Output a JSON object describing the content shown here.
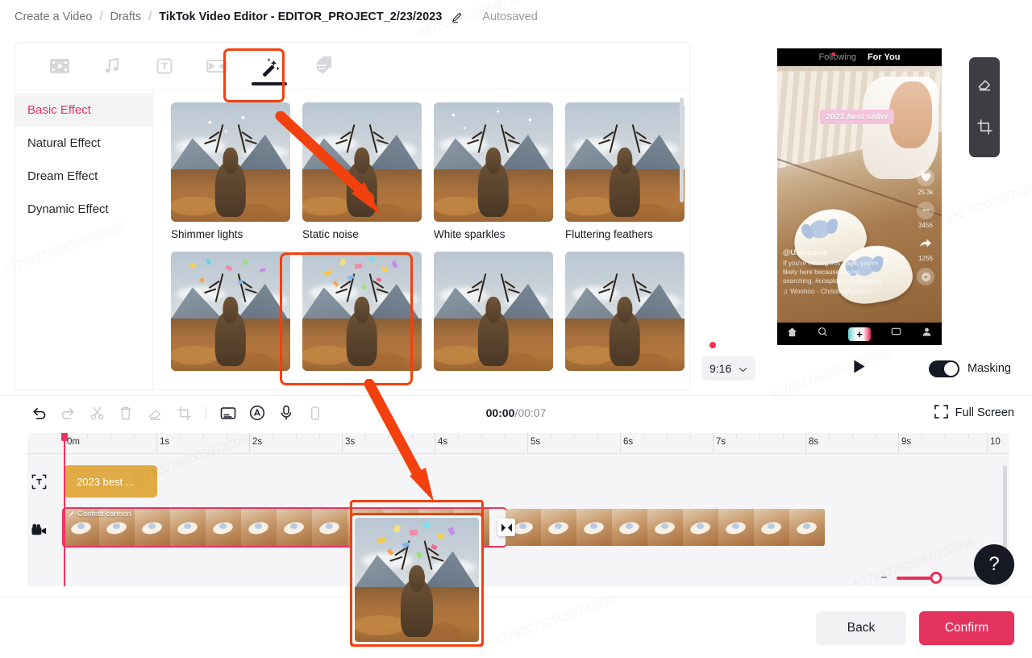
{
  "breadcrumb": {
    "items": [
      "Create a Video",
      "Drafts"
    ],
    "separator": "/",
    "current": "TikTok Video Editor - EDITOR_PROJECT_2/23/2023",
    "edit_icon": "pencil-icon",
    "autosave_status": "Autosaved"
  },
  "tool_tabs": [
    {
      "label": "Media",
      "icon": "video-clip-icon",
      "active": false
    },
    {
      "label": "Audio",
      "icon": "music-note-icon",
      "active": false
    },
    {
      "label": "Text",
      "icon": "text-t-icon",
      "active": false
    },
    {
      "label": "Transition",
      "icon": "transition-icon",
      "active": false
    },
    {
      "label": "Effects",
      "icon": "magic-wand-icon",
      "active": true
    },
    {
      "label": "Sticker",
      "icon": "sticker-icon",
      "active": false
    }
  ],
  "categories": [
    {
      "label": "Basic Effect",
      "active": true
    },
    {
      "label": "Natural Effect",
      "active": false
    },
    {
      "label": "Dream Effect",
      "active": false
    },
    {
      "label": "Dynamic Effect",
      "active": false
    }
  ],
  "effects_row1": [
    {
      "label": "Shimmer lights",
      "selected": false
    },
    {
      "label": "Static noise",
      "selected": false
    },
    {
      "label": "White sparkles",
      "selected": false
    },
    {
      "label": "Fluttering feathers",
      "selected": false
    }
  ],
  "effects_row2": [
    {
      "label": "",
      "selected": false
    },
    {
      "label": "",
      "selected": true
    },
    {
      "label": "",
      "selected": false
    },
    {
      "label": "",
      "selected": false
    }
  ],
  "preview": {
    "phone_tabs": {
      "following": "Following",
      "for_you": "For You"
    },
    "text_overlay": "2023 best seller",
    "username": "@Username",
    "description": "If you're visiting this page, you're likely here because you're searching. #cosplay #21 #cosplay",
    "music": "Woohoo - ChristinaAguilera",
    "likes": "25.3k",
    "comments": "3456",
    "shares": "1256",
    "nav_icons": [
      "home-icon",
      "search-icon",
      "create-plus-icon",
      "inbox-icon",
      "profile-icon"
    ],
    "float_tools": [
      {
        "icon": "eraser-icon",
        "label": "Erase"
      },
      {
        "icon": "crop-icon",
        "label": "Crop"
      }
    ],
    "aspect_ratio": "9:16",
    "aspect_chevron": "chevron-down-icon",
    "play_icon": "play-icon",
    "masking_label": "Masking",
    "masking_on": true
  },
  "timeline_toolbar": {
    "icons": [
      {
        "name": "undo-icon",
        "enabled": true
      },
      {
        "name": "redo-icon",
        "enabled": false
      },
      {
        "name": "scissors-icon",
        "enabled": false
      },
      {
        "name": "trash-icon",
        "enabled": false
      },
      {
        "name": "eraser-icon",
        "enabled": false
      },
      {
        "name": "crop-icon",
        "enabled": false
      },
      {
        "name": "caption-icon",
        "enabled": true
      },
      {
        "name": "auto-caption-icon",
        "enabled": true
      },
      {
        "name": "microphone-icon",
        "enabled": true
      },
      {
        "name": "duplicate-icon",
        "enabled": false
      }
    ],
    "current_time": "00:00",
    "time_separator": "/",
    "total_time": "00:07",
    "full_screen_label": "Full Screen",
    "full_screen_icon": "expand-icon"
  },
  "timeline": {
    "ruler_labels": [
      "0m",
      "1s",
      "2s",
      "3s",
      "4s",
      "5s",
      "6s",
      "7s",
      "8s",
      "9s",
      "10"
    ],
    "tracks": [
      {
        "type": "text",
        "icon": "text-track-icon",
        "clip_label": "2023 best ...",
        "color": "#e0ab44"
      },
      {
        "type": "video",
        "icon": "video-track-icon",
        "effect_badge": "Confetti cannon",
        "effect_badge_icon": "magic-wand-icon",
        "transition_icon": "transition-marker-icon",
        "selected": true
      }
    ],
    "zoom": {
      "minus": "−",
      "plus": "+",
      "value_percent": 45
    }
  },
  "help": {
    "icon": "question-mark-icon",
    "label": "?"
  },
  "footer": {
    "back_label": "Back",
    "confirm_label": "Confirm"
  },
  "colors": {
    "accent": "#e3335c",
    "annotation": "#f2400f",
    "text_clip": "#e0ab44",
    "playhead": "#f0325f"
  },
  "watermark": "6778327620050732038"
}
